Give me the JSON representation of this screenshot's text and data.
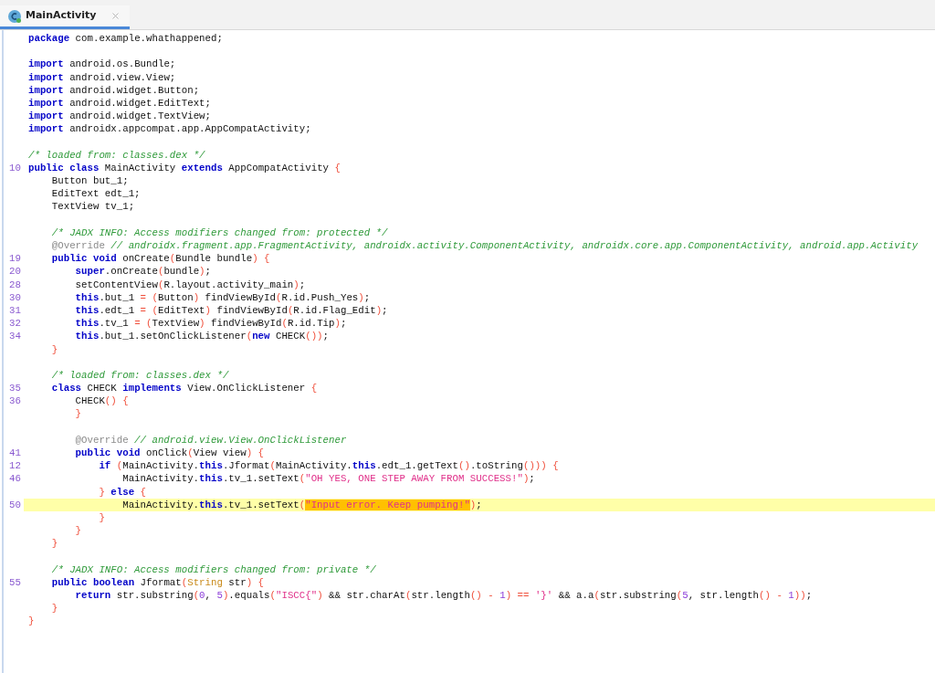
{
  "tab": {
    "title": "MainActivity",
    "selected": true
  },
  "lines": [
    {
      "current": false,
      "tokens": [
        {
          "kind": "kw",
          "text": "package"
        },
        {
          "kind": "plain",
          "text": " com.example.whathappened;"
        }
      ]
    },
    {
      "current": false
    },
    {
      "current": false,
      "tokens": [
        {
          "kind": "kw",
          "text": "import"
        },
        {
          "kind": "plain",
          "text": " android.os.Bundle;"
        }
      ]
    },
    {
      "current": false,
      "tokens": [
        {
          "kind": "kw",
          "text": "import"
        },
        {
          "kind": "plain",
          "text": " android.view.View;"
        }
      ]
    },
    {
      "current": false,
      "tokens": [
        {
          "kind": "kw",
          "text": "import"
        },
        {
          "kind": "plain",
          "text": " android.widget.Button;"
        }
      ]
    },
    {
      "current": false,
      "tokens": [
        {
          "kind": "kw",
          "text": "import"
        },
        {
          "kind": "plain",
          "text": " android.widget.EditText;"
        }
      ]
    },
    {
      "current": false,
      "tokens": [
        {
          "kind": "kw",
          "text": "import"
        },
        {
          "kind": "plain",
          "text": " android.widget.TextView;"
        }
      ]
    },
    {
      "current": false,
      "tokens": [
        {
          "kind": "kw",
          "text": "import"
        },
        {
          "kind": "plain",
          "text": " androidx.appcompat.app.AppCompatActivity;"
        }
      ]
    },
    {
      "current": false
    },
    {
      "current": false,
      "tokens": [
        {
          "kind": "comment",
          "text": "/* loaded from: classes.dex */"
        }
      ]
    },
    {
      "number": "10",
      "current": false,
      "tokens": [
        {
          "kind": "kw",
          "text": "public class"
        },
        {
          "kind": "plain",
          "text": " MainActivity "
        },
        {
          "kind": "kw",
          "text": "extends"
        },
        {
          "kind": "plain",
          "text": " AppCompatActivity "
        },
        {
          "kind": "brace",
          "text": "{"
        }
      ],
      "children": [
        {
          "current": false,
          "tokens": [
            {
              "kind": "plain",
              "text": "Button but_1;"
            }
          ]
        },
        {
          "current": false,
          "tokens": [
            {
              "kind": "plain",
              "text": "EditText edt_1;"
            }
          ]
        },
        {
          "current": false,
          "tokens": [
            {
              "kind": "plain",
              "text": "TextView tv_1;"
            }
          ]
        },
        {
          "current": false
        },
        {
          "current": false,
          "tokens": [
            {
              "kind": "comment",
              "text": "/* JADX INFO: Access modifiers changed from: protected */"
            }
          ]
        },
        {
          "current": false,
          "tokens": [
            {
              "kind": "annotation",
              "text": "@Override"
            },
            {
              "kind": "comment",
              "text": " // androidx.fragment.app.FragmentActivity, androidx.activity.ComponentActivity, androidx.core.app.ComponentActivity, android.app.Activity"
            }
          ]
        },
        {
          "number": "19",
          "current": false,
          "tokens": [
            {
              "kind": "kw",
              "text": "public void"
            },
            {
              "kind": "plain",
              "text": " onCreate"
            },
            {
              "kind": "brace",
              "text": "("
            },
            {
              "kind": "plain",
              "text": "Bundle bundle"
            },
            {
              "kind": "brace",
              "text": ") {"
            }
          ],
          "children": [
            {
              "number": "20",
              "current": false,
              "tokens": [
                {
                  "kind": "kw",
                  "text": "super"
                },
                {
                  "kind": "plain",
                  "text": ".onCreate"
                },
                {
                  "kind": "brace",
                  "text": "("
                },
                {
                  "kind": "plain",
                  "text": "bundle"
                },
                {
                  "kind": "brace",
                  "text": ")"
                },
                {
                  "kind": "plain",
                  "text": ";"
                }
              ]
            },
            {
              "number": "28",
              "current": false,
              "tokens": [
                {
                  "kind": "plain",
                  "text": "setContentView"
                },
                {
                  "kind": "brace",
                  "text": "("
                },
                {
                  "kind": "plain",
                  "text": "R.layout.activity_main"
                },
                {
                  "kind": "brace",
                  "text": ")"
                },
                {
                  "kind": "plain",
                  "text": ";"
                }
              ]
            },
            {
              "number": "30",
              "current": false,
              "tokens": [
                {
                  "kind": "kw",
                  "text": "this"
                },
                {
                  "kind": "plain",
                  "text": ".but_1 "
                },
                {
                  "kind": "brace",
                  "text": "= ("
                },
                {
                  "kind": "plain",
                  "text": "Button"
                },
                {
                  "kind": "brace",
                  "text": ")"
                },
                {
                  "kind": "plain",
                  "text": " findViewById"
                },
                {
                  "kind": "brace",
                  "text": "("
                },
                {
                  "kind": "plain",
                  "text": "R.id.Push_Yes"
                },
                {
                  "kind": "brace",
                  "text": ")"
                },
                {
                  "kind": "plain",
                  "text": ";"
                }
              ]
            },
            {
              "number": "31",
              "current": false,
              "tokens": [
                {
                  "kind": "kw",
                  "text": "this"
                },
                {
                  "kind": "plain",
                  "text": ".edt_1 "
                },
                {
                  "kind": "brace",
                  "text": "= ("
                },
                {
                  "kind": "plain",
                  "text": "EditText"
                },
                {
                  "kind": "brace",
                  "text": ")"
                },
                {
                  "kind": "plain",
                  "text": " findViewById"
                },
                {
                  "kind": "brace",
                  "text": "("
                },
                {
                  "kind": "plain",
                  "text": "R.id.Flag_Edit"
                },
                {
                  "kind": "brace",
                  "text": ")"
                },
                {
                  "kind": "plain",
                  "text": ";"
                }
              ]
            },
            {
              "number": "32",
              "current": false,
              "tokens": [
                {
                  "kind": "kw",
                  "text": "this"
                },
                {
                  "kind": "plain",
                  "text": ".tv_1 "
                },
                {
                  "kind": "brace",
                  "text": "= ("
                },
                {
                  "kind": "plain",
                  "text": "TextView"
                },
                {
                  "kind": "brace",
                  "text": ")"
                },
                {
                  "kind": "plain",
                  "text": " findViewById"
                },
                {
                  "kind": "brace",
                  "text": "("
                },
                {
                  "kind": "plain",
                  "text": "R.id.Tip"
                },
                {
                  "kind": "brace",
                  "text": ")"
                },
                {
                  "kind": "plain",
                  "text": ";"
                }
              ]
            },
            {
              "number": "34",
              "current": false,
              "tokens": [
                {
                  "kind": "kw",
                  "text": "this"
                },
                {
                  "kind": "plain",
                  "text": ".but_1.setOnClickListener"
                },
                {
                  "kind": "brace",
                  "text": "("
                },
                {
                  "kind": "kw",
                  "text": "new"
                },
                {
                  "kind": "plain",
                  "text": " CHECK"
                },
                {
                  "kind": "brace",
                  "text": "())"
                },
                {
                  "kind": "plain",
                  "text": ";"
                }
              ]
            }
          ]
        },
        {
          "current": false,
          "tokens": [
            {
              "kind": "brace",
              "text": "}"
            }
          ]
        },
        {
          "current": false
        },
        {
          "current": false,
          "tokens": [
            {
              "kind": "comment",
              "text": "/* loaded from: classes.dex */"
            }
          ]
        },
        {
          "number": "35",
          "current": false,
          "tokens": [
            {
              "kind": "kw",
              "text": "class"
            },
            {
              "kind": "plain",
              "text": " CHECK "
            },
            {
              "kind": "kw",
              "text": "implements"
            },
            {
              "kind": "plain",
              "text": " View.OnClickListener "
            },
            {
              "kind": "brace",
              "text": "{"
            }
          ],
          "children": [
            {
              "number": "36",
              "current": false,
              "tokens": [
                {
                  "kind": "plain",
                  "text": "CHECK"
                },
                {
                  "kind": "brace",
                  "text": "() {"
                }
              ]
            },
            {
              "current": false,
              "tokens": [
                {
                  "kind": "brace",
                  "text": "}"
                }
              ]
            },
            {
              "current": false
            },
            {
              "current": false,
              "tokens": [
                {
                  "kind": "annotation",
                  "text": "@Override"
                },
                {
                  "kind": "comment",
                  "text": " // android.view.View.OnClickListener"
                }
              ]
            },
            {
              "number": "41",
              "current": false,
              "tokens": [
                {
                  "kind": "kw",
                  "text": "public void"
                },
                {
                  "kind": "plain",
                  "text": " onClick"
                },
                {
                  "kind": "brace",
                  "text": "("
                },
                {
                  "kind": "plain",
                  "text": "View view"
                },
                {
                  "kind": "brace",
                  "text": ") {"
                }
              ],
              "children": [
                {
                  "number": "12",
                  "current": false,
                  "tokens": [
                    {
                      "kind": "kw",
                      "text": "if"
                    },
                    {
                      "kind": "brace",
                      "text": " ("
                    },
                    {
                      "kind": "plain",
                      "text": "MainActivity."
                    },
                    {
                      "kind": "kw",
                      "text": "this"
                    },
                    {
                      "kind": "plain",
                      "text": ".Jformat"
                    },
                    {
                      "kind": "brace",
                      "text": "("
                    },
                    {
                      "kind": "plain",
                      "text": "MainActivity."
                    },
                    {
                      "kind": "kw",
                      "text": "this"
                    },
                    {
                      "kind": "plain",
                      "text": ".edt_1.getText"
                    },
                    {
                      "kind": "brace",
                      "text": "()"
                    },
                    {
                      "kind": "plain",
                      "text": ".toString"
                    },
                    {
                      "kind": "brace",
                      "text": "())) {"
                    }
                  ],
                  "children": [
                    {
                      "number": "46",
                      "current": false,
                      "tokens": [
                        {
                          "kind": "plain",
                          "text": "MainActivity."
                        },
                        {
                          "kind": "kw",
                          "text": "this"
                        },
                        {
                          "kind": "plain",
                          "text": ".tv_1.setText"
                        },
                        {
                          "kind": "brace",
                          "text": "("
                        },
                        {
                          "kind": "string",
                          "text": "\"OH YES, ONE STEP AWAY FROM SUCCESS!\""
                        },
                        {
                          "kind": "brace",
                          "text": ")"
                        },
                        {
                          "kind": "plain",
                          "text": ";"
                        }
                      ]
                    }
                  ]
                },
                {
                  "current": false,
                  "tokens": [
                    {
                      "kind": "brace",
                      "text": "}"
                    },
                    {
                      "kind": "kw",
                      "text": " else"
                    },
                    {
                      "kind": "brace",
                      "text": " {"
                    }
                  ],
                  "children": [
                    {
                      "number": "50",
                      "current": true,
                      "tokens": [
                        {
                          "kind": "plain",
                          "text": "MainActivity."
                        },
                        {
                          "kind": "kw",
                          "text": "this"
                        },
                        {
                          "kind": "plain",
                          "text": ".tv_1.setText"
                        },
                        {
                          "kind": "brace",
                          "text": "("
                        },
                        {
                          "kind": "match",
                          "text": "\"Input error. Keep pumping!\""
                        },
                        {
                          "kind": "brace",
                          "text": ")"
                        },
                        {
                          "kind": "plain",
                          "text": ";"
                        }
                      ]
                    }
                  ]
                },
                {
                  "current": false,
                  "tokens": [
                    {
                      "kind": "brace",
                      "text": "}"
                    }
                  ]
                }
              ]
            },
            {
              "current": false,
              "tokens": [
                {
                  "kind": "brace",
                  "text": "}"
                }
              ]
            }
          ]
        },
        {
          "current": false,
          "tokens": [
            {
              "kind": "brace",
              "text": "}"
            }
          ]
        },
        {
          "current": false
        },
        {
          "current": false,
          "tokens": [
            {
              "kind": "comment",
              "text": "/* JADX INFO: Access modifiers changed from: private */"
            }
          ]
        },
        {
          "number": "55",
          "current": false,
          "tokens": [
            {
              "kind": "kw",
              "text": "public boolean"
            },
            {
              "kind": "plain",
              "text": " Jformat"
            },
            {
              "kind": "brace",
              "text": "("
            },
            {
              "kind": "type",
              "text": "String"
            },
            {
              "kind": "plain",
              "text": " str"
            },
            {
              "kind": "brace",
              "text": ") {"
            }
          ],
          "children": [
            {
              "current": false,
              "tokens": [
                {
                  "kind": "kw",
                  "text": "return"
                },
                {
                  "kind": "plain",
                  "text": " str.substring"
                },
                {
                  "kind": "brace",
                  "text": "("
                },
                {
                  "kind": "number",
                  "text": "0"
                },
                {
                  "kind": "plain",
                  "text": ", "
                },
                {
                  "kind": "number",
                  "text": "5"
                },
                {
                  "kind": "brace",
                  "text": ")"
                },
                {
                  "kind": "plain",
                  "text": ".equals"
                },
                {
                  "kind": "brace",
                  "text": "("
                },
                {
                  "kind": "string",
                  "text": "\"ISCC{\""
                },
                {
                  "kind": "brace",
                  "text": ")"
                },
                {
                  "kind": "plain",
                  "text": " && str.charAt"
                },
                {
                  "kind": "brace",
                  "text": "("
                },
                {
                  "kind": "plain",
                  "text": "str.length"
                },
                {
                  "kind": "brace",
                  "text": "() -"
                },
                {
                  "kind": "number",
                  "text": " 1"
                },
                {
                  "kind": "brace",
                  "text": ") =="
                },
                {
                  "kind": "string",
                  "text": " '}'"
                },
                {
                  "kind": "plain",
                  "text": " && a.a"
                },
                {
                  "kind": "brace",
                  "text": "("
                },
                {
                  "kind": "plain",
                  "text": "str.substring"
                },
                {
                  "kind": "brace",
                  "text": "("
                },
                {
                  "kind": "number",
                  "text": "5"
                },
                {
                  "kind": "plain",
                  "text": ", str.length"
                },
                {
                  "kind": "brace",
                  "text": "() -"
                },
                {
                  "kind": "number",
                  "text": " 1"
                },
                {
                  "kind": "brace",
                  "text": "))"
                },
                {
                  "kind": "plain",
                  "text": ";"
                }
              ]
            }
          ]
        },
        {
          "current": false,
          "tokens": [
            {
              "kind": "brace",
              "text": "}"
            }
          ]
        }
      ]
    },
    {
      "current": false,
      "tokens": [
        {
          "kind": "brace",
          "text": "}"
        }
      ]
    }
  ]
}
